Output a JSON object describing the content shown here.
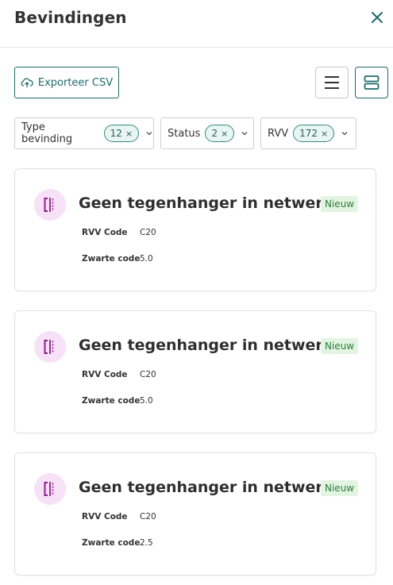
{
  "header": {
    "title": "Bevindingen"
  },
  "toolbar": {
    "export_label": "Exporteer CSV"
  },
  "filters": [
    {
      "label": "Type bevinding",
      "count": "12"
    },
    {
      "label": "Status",
      "count": "2"
    },
    {
      "label": "RVV",
      "count": "172"
    }
  ],
  "cards": [
    {
      "title": "Geen tegenhanger in netwerk",
      "badge": "Nieuw",
      "rvv_label": "RVV Code",
      "rvv_value": "C20",
      "zwarte_label": "Zwarte code",
      "zwarte_value": "5.0"
    },
    {
      "title": "Geen tegenhanger in netwerk",
      "badge": "Nieuw",
      "rvv_label": "RVV Code",
      "rvv_value": "C20",
      "zwarte_label": "Zwarte code",
      "zwarte_value": "5.0"
    },
    {
      "title": "Geen tegenhanger in netwerk",
      "badge": "Nieuw",
      "rvv_label": "RVV Code",
      "rvv_value": "C20",
      "zwarte_label": "Zwarte code",
      "zwarte_value": "2.5"
    }
  ],
  "colors": {
    "accent": "#1f6b6b",
    "chip_bg": "#e8f5f2",
    "icon_bg": "#f7e1f6",
    "badge_bg": "#e3f4e3",
    "badge_text": "#2d7d3a"
  },
  "icons": {
    "close": "close-icon",
    "export": "cloud-upload-icon",
    "list": "list-view-icon",
    "card": "card-view-icon",
    "finding": "split-icon",
    "chevron": "chevron-down-icon",
    "chip_remove": "chip-remove-icon"
  }
}
